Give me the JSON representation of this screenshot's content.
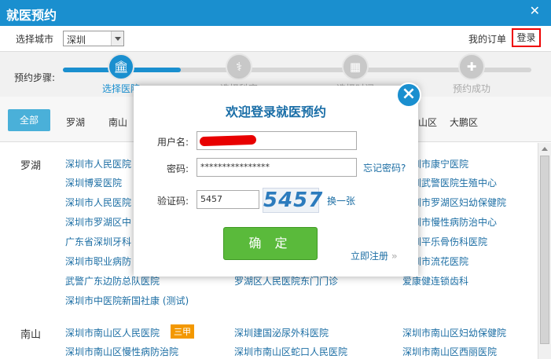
{
  "window": {
    "title": "就医预约",
    "close": "✕"
  },
  "topbar": {
    "city_label": "选择城市",
    "city_value": "深圳",
    "my_orders": "我的订单",
    "login": "登录"
  },
  "steps": {
    "label": "预约步骤:",
    "items": [
      {
        "label": "选择医院",
        "icon": "hospital-icon",
        "glyph": "🏛"
      },
      {
        "label": "选择科室",
        "icon": "stethoscope-icon",
        "glyph": "⚕"
      },
      {
        "label": "选择时间",
        "icon": "calendar-icon",
        "glyph": "▦"
      },
      {
        "label": "预约成功",
        "icon": "medal-icon",
        "glyph": "✚"
      }
    ]
  },
  "districts": {
    "all": "全部",
    "items": [
      "罗湖",
      "南山",
      "山区",
      "大鹏区"
    ]
  },
  "regions": [
    {
      "name": "罗湖",
      "hospitals": [
        "深圳市人民医院",
        "深圳博爱医院",
        "深圳市人民医院",
        "深圳市罗湖区中",
        "广东省深圳牙科",
        "深圳市职业病防",
        "武警广东边防总队医院",
        "深圳市中医院新国社康 (测试)",
        "深圳市康宁医院",
        "深圳武警医院生殖中心",
        "深圳市罗湖区妇幼保健院",
        "深圳市慢性病防治中心",
        "深圳平乐骨伤科医院",
        "深圳市流花医院",
        "罗湖区人民医院东门门诊",
        "爱康健连锁齿科"
      ]
    },
    {
      "name": "南山",
      "hospitals": [
        "深圳市南山区人民医院",
        "深圳市南山区慢性病防治院",
        "深圳建国泌尿外科医院",
        "深圳市南山区蛇口人民医院",
        "深圳市南山区妇幼保健院",
        "深圳市南山区西丽医院"
      ],
      "badge": "三甲"
    }
  ],
  "login_dialog": {
    "title": "欢迎登录就医预约",
    "username_label": "用户名:",
    "password_label": "密码:",
    "password_value": "****************",
    "forgot": "忘记密码?",
    "captcha_label": "验证码:",
    "captcha_value": "5457",
    "captcha_image_text": "5457",
    "refresh": "换一张",
    "confirm": "确 定",
    "register": "立即注册",
    "register_arrows": "»",
    "close": "×"
  },
  "colors": {
    "primary": "#1a8fcf",
    "confirm": "#5aba3b",
    "badge": "#f39800",
    "highlight": "#e00000"
  }
}
